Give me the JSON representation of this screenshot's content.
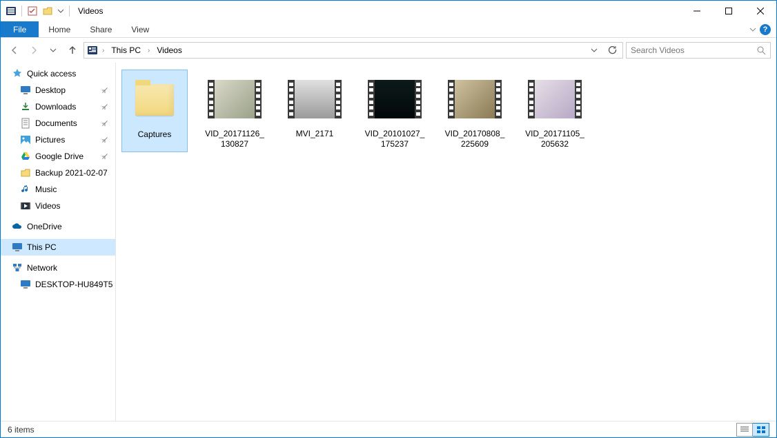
{
  "title": "Videos",
  "ribbon": {
    "file": "File",
    "home": "Home",
    "share": "Share",
    "view": "View"
  },
  "breadcrumb": {
    "seg1": "This PC",
    "seg2": "Videos"
  },
  "search": {
    "placeholder": "Search Videos"
  },
  "sidebar": {
    "quick_access": "Quick access",
    "items": [
      {
        "label": "Desktop",
        "pinned": true
      },
      {
        "label": "Downloads",
        "pinned": true
      },
      {
        "label": "Documents",
        "pinned": true
      },
      {
        "label": "Pictures",
        "pinned": true
      },
      {
        "label": "Google Drive",
        "pinned": true
      },
      {
        "label": "Backup 2021-02-07",
        "pinned": false
      },
      {
        "label": "Music",
        "pinned": false
      },
      {
        "label": "Videos",
        "pinned": false
      }
    ],
    "onedrive": "OneDrive",
    "this_pc": "This PC",
    "network": "Network",
    "netpc": "DESKTOP-HU849T5"
  },
  "items": [
    {
      "name": "Captures",
      "type": "folder",
      "selected": true
    },
    {
      "name": "VID_20171126_130827",
      "type": "video",
      "bg": "linear-gradient(135deg,#d9d9c8,#9aa18a)"
    },
    {
      "name": "MVI_2171",
      "type": "video",
      "bg": "linear-gradient(#e0e0e0,#9a9a9a)"
    },
    {
      "name": "VID_20101027_175237",
      "type": "video",
      "bg": "linear-gradient(#0d1a1a,#02080a)"
    },
    {
      "name": "VID_20170808_225609",
      "type": "video",
      "bg": "linear-gradient(135deg,#cfc2a0,#8a7a55)"
    },
    {
      "name": "VID_20171105_205632",
      "type": "video",
      "bg": "linear-gradient(135deg,#e6dfe6,#b7a8c6)"
    }
  ],
  "status": {
    "text": "6 items"
  }
}
